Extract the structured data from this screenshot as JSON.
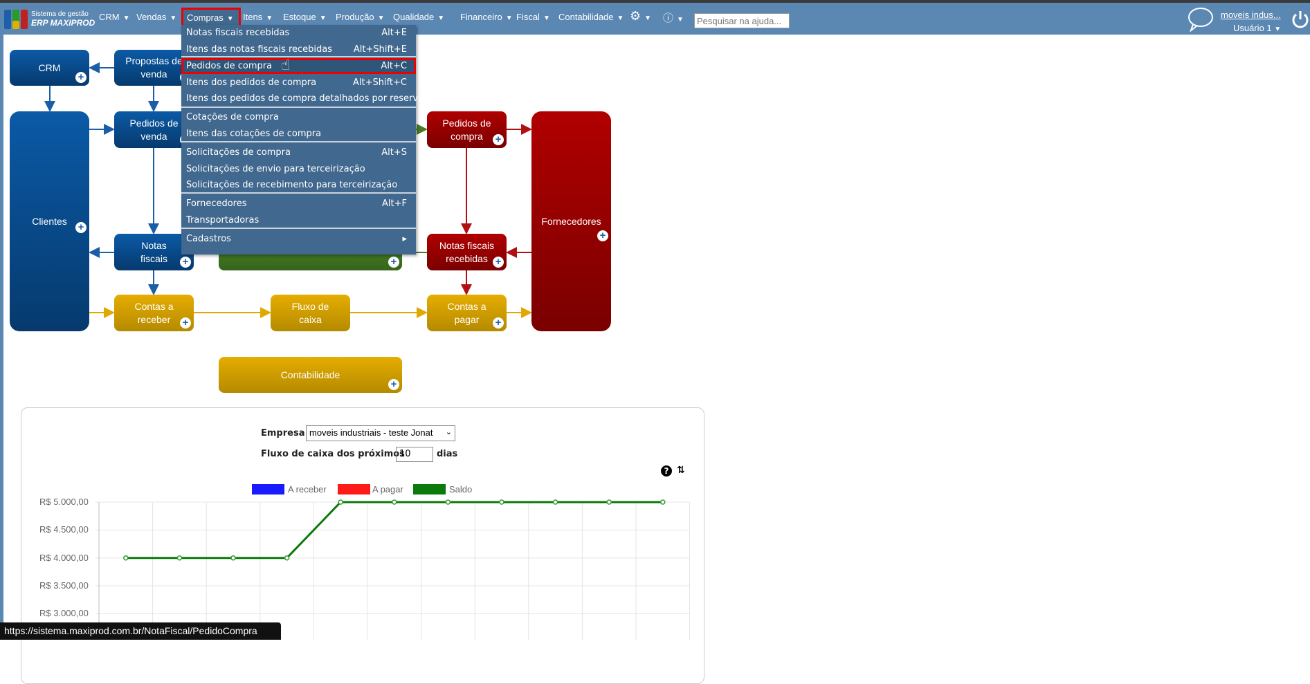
{
  "header": {
    "logo_line1": "Sistema de gestão",
    "logo_line2": "ERP MAXIPROD",
    "nav": [
      "CRM",
      "Vendas",
      "Compras",
      "Itens",
      "Estoque",
      "Produção",
      "Qualidade",
      "Financeiro",
      "Fiscal",
      "Contabilidade"
    ],
    "search_placeholder": "Pesquisar na ajuda...",
    "company_link": "moveis indus...",
    "user": "Usuário 1"
  },
  "menu": [
    {
      "label": "Notas fiscais recebidas",
      "shortcut": "Alt+E"
    },
    {
      "label": "Itens das notas fiscais recebidas",
      "shortcut": "Alt+Shift+E"
    },
    {
      "label": "Pedidos de compra",
      "shortcut": "Alt+C"
    },
    {
      "label": "Itens dos pedidos de compra",
      "shortcut": "Alt+Shift+C"
    },
    {
      "label": "Itens dos pedidos de compra detalhados por reserva",
      "shortcut": ""
    },
    {
      "label": "Cotações de compra",
      "shortcut": ""
    },
    {
      "label": "Itens das cotações de compra",
      "shortcut": ""
    },
    {
      "label": "Solicitações de compra",
      "shortcut": "Alt+S"
    },
    {
      "label": "Solicitações de envio para terceirização",
      "shortcut": ""
    },
    {
      "label": "Solicitações de recebimento para terceirização",
      "shortcut": ""
    },
    {
      "label": "Fornecedores",
      "shortcut": "Alt+F"
    },
    {
      "label": "Transportadoras",
      "shortcut": ""
    },
    {
      "label": "Cadastros",
      "shortcut": "▸"
    }
  ],
  "diagram": {
    "crm": "CRM",
    "propostas": "Propostas de venda",
    "clientes": "Clientes",
    "pedidos_venda": "Pedidos de venda",
    "notas_fiscais": "Notas fiscais",
    "pedidos_compra": "Pedidos de compra",
    "fornecedores": "Fornecedores",
    "nf_recebidas": "Notas fiscais recebidas",
    "contas_receber": "Contas a receber",
    "fluxo": "Fluxo de caixa",
    "contas_pagar": "Contas a pagar",
    "contabilidade": "Contabilidade"
  },
  "cashflow": {
    "empresa_label": "Empresa",
    "empresa_value": "moveis industriais - teste Jonat",
    "dias_prefix": "Fluxo de caixa dos próximos",
    "dias_value": "10",
    "dias_suffix": "dias"
  },
  "chart_data": {
    "type": "line",
    "legend": [
      "A receber",
      "A pagar",
      "Saldo"
    ],
    "colors": {
      "A receber": "#1a1aff",
      "A pagar": "#ff1a1a",
      "Saldo": "#0a7a0a"
    },
    "yticks": [
      "R$ 5.000,00",
      "R$ 4.500,00",
      "R$ 4.000,00",
      "R$ 3.500,00",
      "R$ 3.000,00"
    ],
    "ytick_values": [
      5000,
      4500,
      4000,
      3500,
      3000
    ],
    "series": [
      {
        "name": "Saldo",
        "values": [
          4000,
          4000,
          4000,
          4000,
          5000,
          5000,
          5000,
          5000,
          5000,
          5000,
          5000
        ]
      }
    ],
    "legend_position": "top",
    "grid": true
  },
  "status_url": "https://sistema.maxiprod.com.br/NotaFiscal/PedidoCompra"
}
